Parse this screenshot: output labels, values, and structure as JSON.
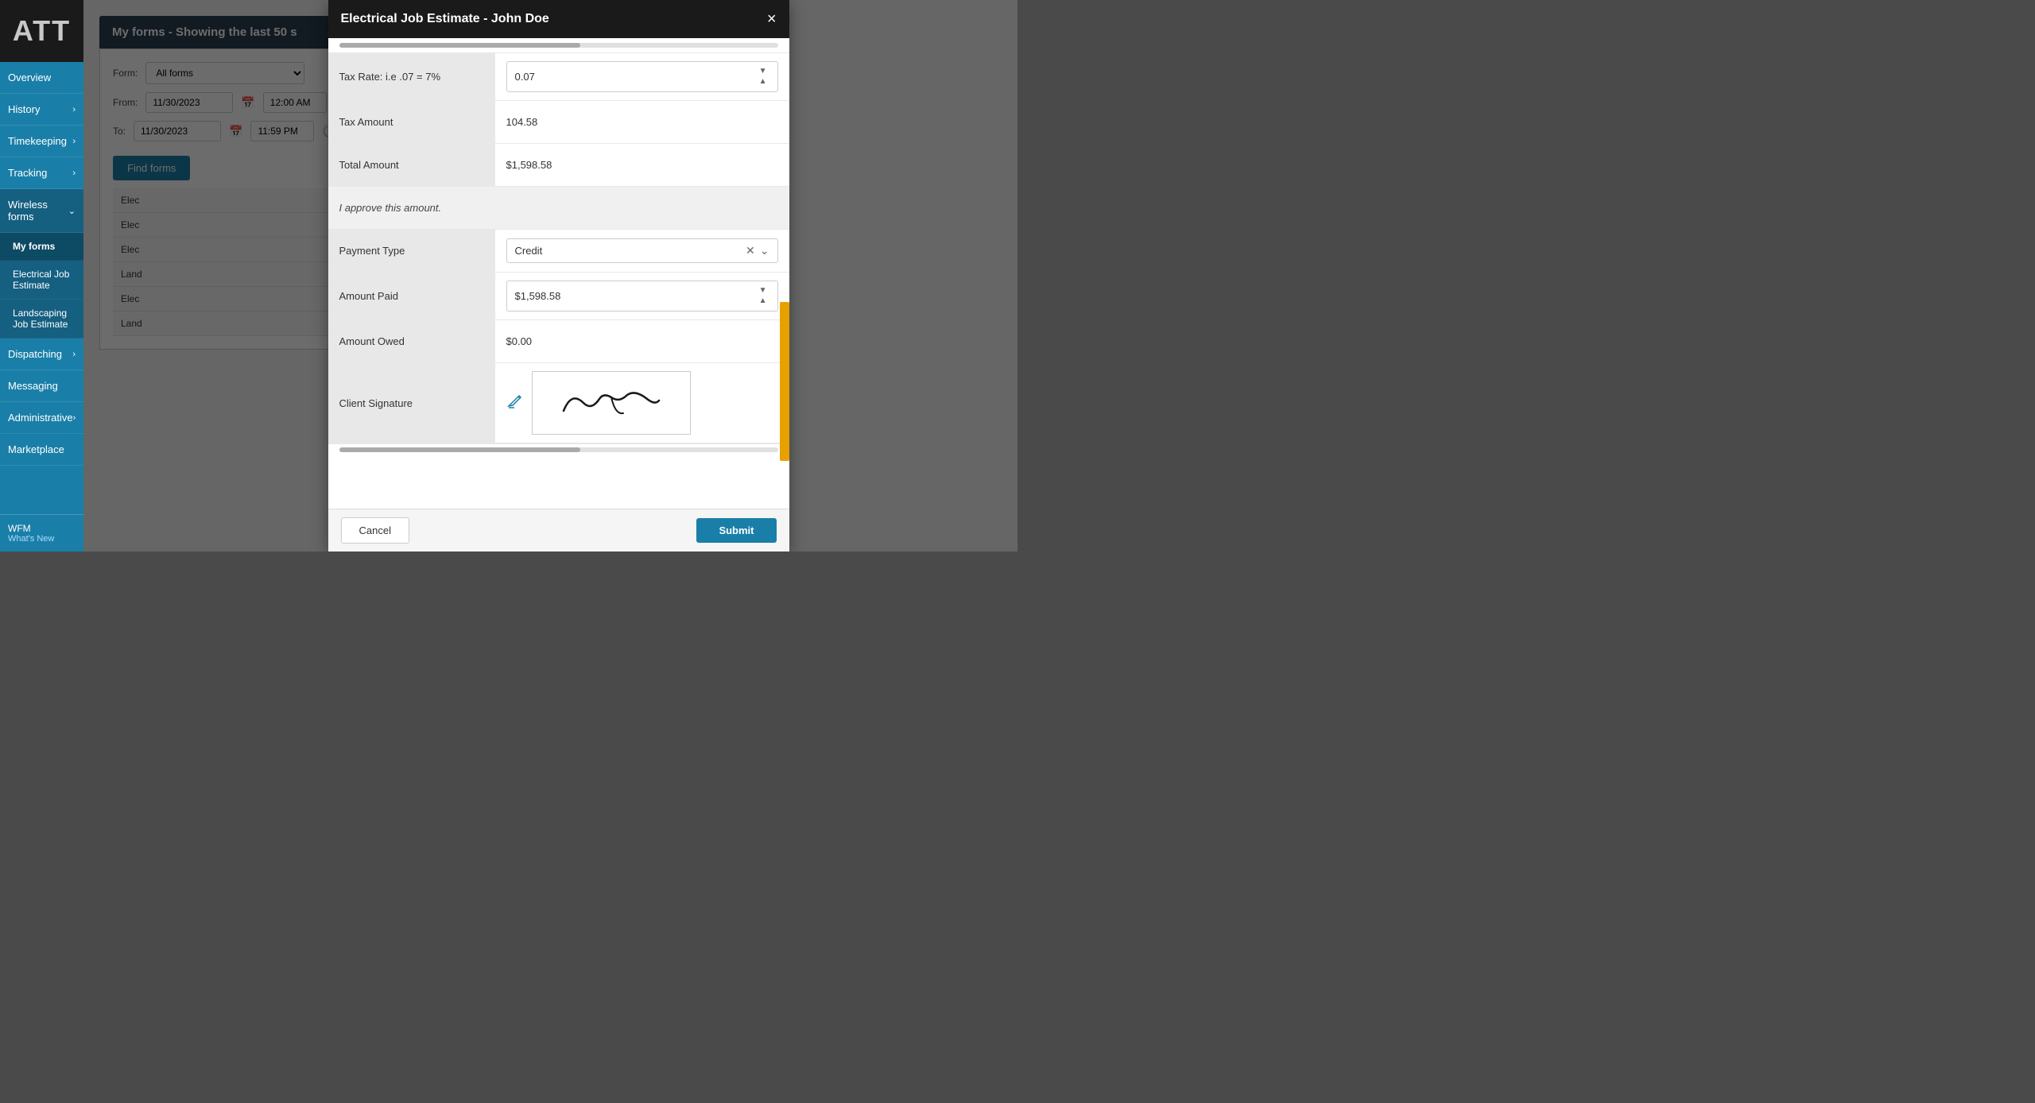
{
  "app": {
    "logo": "ATT"
  },
  "sidebar": {
    "items": [
      {
        "id": "overview",
        "label": "Overview",
        "hasChevron": false,
        "active": false
      },
      {
        "id": "history",
        "label": "History",
        "hasChevron": true,
        "active": false
      },
      {
        "id": "timekeeping",
        "label": "Timekeeping",
        "hasChevron": true,
        "active": false
      },
      {
        "id": "tracking",
        "label": "Tracking",
        "hasChevron": true,
        "active": false
      },
      {
        "id": "wireless-forms",
        "label": "Wireless forms",
        "hasChevron": true,
        "active": true
      },
      {
        "id": "dispatching",
        "label": "Dispatching",
        "hasChevron": true,
        "active": false
      },
      {
        "id": "messaging",
        "label": "Messaging",
        "hasChevron": false,
        "active": false
      },
      {
        "id": "administrative",
        "label": "Administrative",
        "hasChevron": true,
        "active": false
      },
      {
        "id": "marketplace",
        "label": "Marketplace",
        "hasChevron": false,
        "active": false
      }
    ],
    "subitems": [
      {
        "id": "my-forms",
        "label": "My forms",
        "active": true
      },
      {
        "id": "electrical-job",
        "label": "Electrical Job Estimate",
        "active": false
      },
      {
        "id": "landscaping-job",
        "label": "Landscaping Job Estimate",
        "active": false
      }
    ],
    "bottom": {
      "line1": "WFM",
      "line2": "What's New"
    }
  },
  "background": {
    "header": "My forms - Showing the last 50 s",
    "form_label": "Form:",
    "form_value": "All forms",
    "from_label": "From:",
    "from_date": "11/30/2023",
    "from_time": "12:00 AM",
    "to_label": "To:",
    "to_date": "11/30/2023",
    "to_time": "11:59 PM",
    "find_button": "Find forms",
    "list_items": [
      "Elec",
      "Elec",
      "Elec",
      "Land",
      "Elec",
      "Land"
    ]
  },
  "modal": {
    "title": "Electrical Job Estimate - John Doe",
    "close_label": "×",
    "fields": [
      {
        "id": "tax-rate",
        "label": "Tax Rate: i.e .07 = 7%",
        "type": "spinner",
        "value": "0.07"
      },
      {
        "id": "tax-amount",
        "label": "Tax Amount",
        "type": "static",
        "value": "104.58"
      },
      {
        "id": "total-amount",
        "label": "Total Amount",
        "type": "static",
        "value": "$1,598.58"
      },
      {
        "id": "approve",
        "label": "",
        "type": "full-text",
        "value": "I approve this amount."
      },
      {
        "id": "payment-type",
        "label": "Payment Type",
        "type": "select-clearable",
        "value": "Credit"
      },
      {
        "id": "amount-paid",
        "label": "Amount Paid",
        "type": "spinner",
        "value": "$1,598.58"
      },
      {
        "id": "amount-owed",
        "label": "Amount Owed",
        "type": "static",
        "value": "$0.00"
      },
      {
        "id": "client-signature",
        "label": "Client Signature",
        "type": "signature",
        "value": ""
      }
    ],
    "footer": {
      "cancel_label": "Cancel",
      "submit_label": "Submit"
    }
  }
}
